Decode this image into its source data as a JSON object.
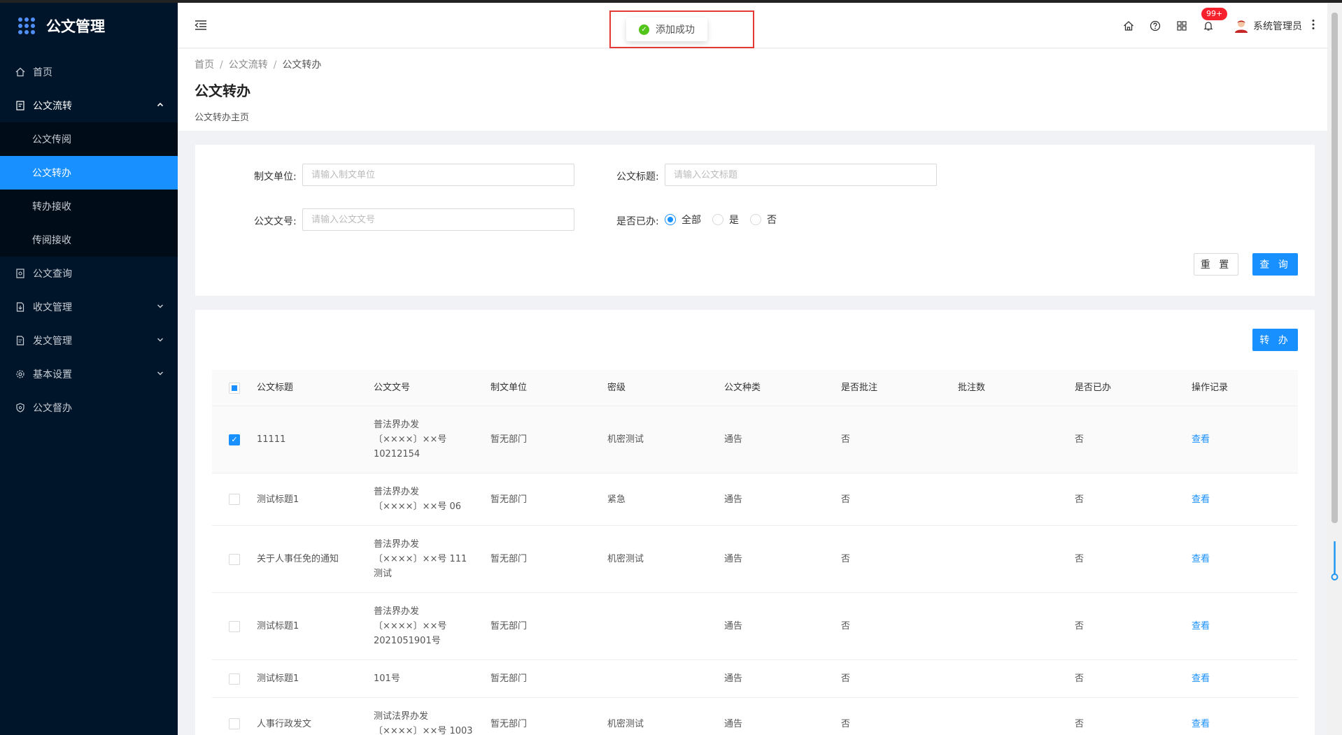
{
  "app": {
    "title": "公文管理"
  },
  "sidebar": {
    "items": [
      {
        "label": "首页",
        "icon": "home-icon"
      },
      {
        "label": "公文流转",
        "icon": "doc-flow-icon",
        "open": true,
        "children": [
          {
            "label": "公文传阅",
            "active": false
          },
          {
            "label": "公文转办",
            "active": true
          },
          {
            "label": "转办接收",
            "active": false
          },
          {
            "label": "传阅接收",
            "active": false
          }
        ]
      },
      {
        "label": "公文查询",
        "icon": "doc-search-icon"
      },
      {
        "label": "收文管理",
        "icon": "inbox-doc-icon"
      },
      {
        "label": "发文管理",
        "icon": "outbox-doc-icon"
      },
      {
        "label": "基本设置",
        "icon": "gear-icon"
      },
      {
        "label": "公文督办",
        "icon": "shield-icon"
      }
    ]
  },
  "header": {
    "notification_badge": "99+",
    "user_name": "系统管理员"
  },
  "toast": {
    "message": "添加成功"
  },
  "page": {
    "breadcrumb": [
      "首页",
      "公文流转",
      "公文转办"
    ],
    "title": "公文转办",
    "subtitle": "公文转办主页"
  },
  "search": {
    "unit_label": "制文单位:",
    "unit_placeholder": "请输入制文单位",
    "title_label": "公文标题:",
    "title_placeholder": "请输入公文标题",
    "no_label": "公文文号:",
    "no_placeholder": "请输入公文文号",
    "done_label": "是否已办:",
    "done_options": [
      "全部",
      "是",
      "否"
    ],
    "done_selected": "全部",
    "reset_label": "重 置",
    "query_label": "查 询"
  },
  "table": {
    "transfer_label": "转 办",
    "columns": [
      "公文标题",
      "公文文号",
      "制文单位",
      "密级",
      "公文种类",
      "是否批注",
      "批注数",
      "是否已办",
      "操作记录"
    ],
    "rows": [
      {
        "checked": true,
        "title": "11111",
        "no": [
          "普法界办发",
          "〔××××〕××号",
          "10212154"
        ],
        "unit": "暂无部门",
        "secret": "机密测试",
        "kind": "通告",
        "annotated": "否",
        "count": "",
        "done": "否",
        "op": "查看"
      },
      {
        "checked": false,
        "title": "测试标题1",
        "no": [
          "普法界办发",
          "〔××××〕××号 06"
        ],
        "unit": "暂无部门",
        "secret": "紧急",
        "kind": "通告",
        "annotated": "否",
        "count": "",
        "done": "否",
        "op": "查看"
      },
      {
        "checked": false,
        "title": "关于人事任免的通知",
        "no": [
          "普法界办发",
          "〔××××〕××号 111",
          "测试"
        ],
        "unit": "暂无部门",
        "secret": "机密测试",
        "kind": "通告",
        "annotated": "否",
        "count": "",
        "done": "否",
        "op": "查看"
      },
      {
        "checked": false,
        "title": "测试标题1",
        "no": [
          "普法界办发",
          "〔××××〕××号",
          "2021051901号"
        ],
        "unit": "暂无部门",
        "secret": "",
        "kind": "通告",
        "annotated": "否",
        "count": "",
        "done": "否",
        "op": "查看"
      },
      {
        "checked": false,
        "title": "测试标题1",
        "no": [
          "101号"
        ],
        "unit": "暂无部门",
        "secret": "",
        "kind": "通告",
        "annotated": "否",
        "count": "",
        "done": "否",
        "op": "查看"
      },
      {
        "checked": false,
        "title": "人事行政发文",
        "no": [
          "测试法界办发",
          "〔××××〕××号 1003"
        ],
        "unit": "暂无部门",
        "secret": "机密测试",
        "kind": "通告",
        "annotated": "否",
        "count": "",
        "done": "否",
        "op": "查看"
      }
    ]
  },
  "colors": {
    "sidebar_bg": "#001529",
    "primary": "#1890ff",
    "success": "#52c41a",
    "badge": "#f5222d"
  }
}
